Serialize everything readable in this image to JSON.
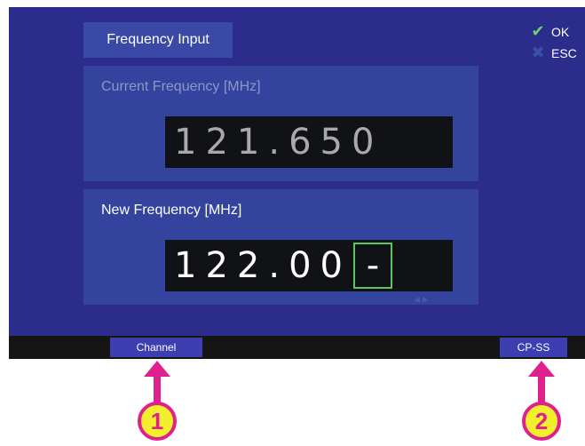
{
  "screen": {
    "title": "Frequency Input",
    "softkeys": {
      "ok_label": "OK",
      "esc_label": "ESC"
    }
  },
  "current_panel": {
    "label": "Current Frequency [MHz]",
    "value": "121.650"
  },
  "new_panel": {
    "label": "New Frequency [MHz]",
    "value_entered": "122.00",
    "cursor_char": "-"
  },
  "bottom_bar": {
    "left_button": "Channel",
    "right_button": "CP-SS"
  },
  "callouts": [
    "1",
    "2"
  ],
  "colors": {
    "screen_bg": "#2b2c8c",
    "panel_bg": "#34439e",
    "cursor_border": "#5ec65e",
    "ok_check": "#6bd36b",
    "callout_fill": "#f2ef2c",
    "callout_accent": "#e0208c"
  },
  "icons": {
    "ok": "check-icon",
    "esc": "x-icon"
  }
}
